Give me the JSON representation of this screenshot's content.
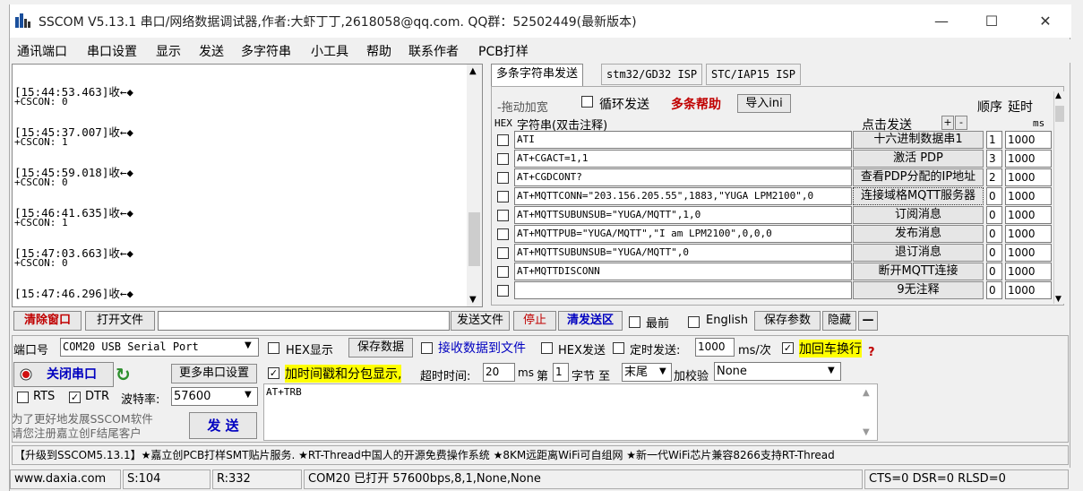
{
  "window": {
    "title": "SSCOM V5.13.1 串口/网络数据调试器,作者:大虾丁丁,2618058@qq.com. QQ群：52502449(最新版本)",
    "min_symbol": "—",
    "max_symbol": "☐",
    "close_symbol": "✕"
  },
  "menu": [
    "通讯端口",
    "串口设置",
    "显示",
    "发送",
    "多字符串",
    "小工具",
    "帮助",
    "联系作者",
    "PCB打样"
  ],
  "receive": {
    "lines": [
      {
        "ts": "[15:44:53.463]收←◆",
        "val": "+CSCON: 0"
      },
      {
        "ts": "[15:45:37.007]收←◆",
        "val": "+CSCON: 1"
      },
      {
        "ts": "[15:45:59.018]收←◆",
        "val": "+CSCON: 0"
      },
      {
        "ts": "[15:46:41.635]收←◆",
        "val": "+CSCON: 1"
      },
      {
        "ts": "[15:47:03.663]收←◆",
        "val": "+CSCON: 0"
      },
      {
        "ts": "[15:47:46.296]收←◆",
        "val": ""
      }
    ]
  },
  "tabs": [
    "多条字符串发送",
    "stm32/GD32 ISP",
    "STC/IAP15 ISP"
  ],
  "multi": {
    "drag_label": "-拖动加宽",
    "loop_label": "循环发送",
    "help_label": "多条帮助",
    "import_label": "导入ini",
    "order_header": "顺序",
    "delay_header": "延时",
    "ms_label": "ms",
    "hex_header": "HEX",
    "str_header": "字符串(双击注释)",
    "click_header": "点击发送",
    "plus": "+",
    "minus": "-",
    "rows": [
      {
        "cmd": "ATI",
        "btn": "十六进制数据串1",
        "order": "1",
        "delay": "1000"
      },
      {
        "cmd": "AT+CGACT=1,1",
        "btn": "激活 PDP",
        "order": "3",
        "delay": "1000"
      },
      {
        "cmd": "AT+CGDCONT?",
        "btn": "查看PDP分配的IP地址",
        "order": "2",
        "delay": "1000"
      },
      {
        "cmd": "AT+MQTTCONN=\"203.156.205.55\",1883,\"YUGA LPM2100\",0",
        "btn": "连接域格MQTT服务器",
        "order": "0",
        "delay": "1000"
      },
      {
        "cmd": "AT+MQTTSUBUNSUB=\"YUGA/MQTT\",1,0",
        "btn": "订阅消息",
        "order": "0",
        "delay": "1000"
      },
      {
        "cmd": "AT+MQTTPUB=\"YUGA/MQTT\",\"I am LPM2100\",0,0,0",
        "btn": "发布消息",
        "order": "0",
        "delay": "1000"
      },
      {
        "cmd": "AT+MQTTSUBUNSUB=\"YUGA/MQTT\",0",
        "btn": "退订消息",
        "order": "0",
        "delay": "1000"
      },
      {
        "cmd": "AT+MQTTDISCONN",
        "btn": "断开MQTT连接",
        "order": "0",
        "delay": "1000"
      },
      {
        "cmd": "",
        "btn": "9无注释",
        "order": "0",
        "delay": "1000"
      }
    ]
  },
  "toolbar": {
    "clear": "清除窗口",
    "open_file": "打开文件",
    "send_file": "发送文件",
    "stop": "停止",
    "clear_send": "清发送区",
    "front": "最前",
    "english": "English",
    "save_params": "保存参数",
    "hide": "隐藏",
    "dash": "—"
  },
  "settings": {
    "port_label": "端口号",
    "port_value": "COM20 USB Serial Port",
    "hex_display": "HEX显示",
    "save_data": "保存数据",
    "recv_to_file": "接收数据到文件",
    "hex_send": "HEX发送",
    "timed_send": "定时发送:",
    "timed_value": "1000",
    "ms_per": "ms/次",
    "add_crlf": "加回车换行",
    "question": "?",
    "close_port": "关闭串口",
    "more_settings": "更多串口设置",
    "add_timestamp": "加时间戳和分包显示,",
    "timeout_label": "超时时间:",
    "timeout_value": "20",
    "ms": "ms",
    "byte_no_label": "第",
    "byte_no": "1",
    "byte_to": "字节 至",
    "byte_end": "末尾",
    "checksum_label": "加校验",
    "checksum_value": "None",
    "rts": "RTS",
    "dtr": "DTR",
    "baud_label": "波特率:",
    "baud_value": "57600",
    "send_text": "AT+TRB",
    "promo": "为了更好地发展SSCOM软件\n请您注册嘉立创F结尾客户",
    "send_btn": "发 送"
  },
  "marquee": "【升级到SSCOM5.13.1】★嘉立创PCB打样SMT贴片服务. ★RT-Thread中国人的开源免费操作系统 ★8KM远距离WiFi可自组网 ★新一代WiFi芯片兼容8266支持RT-Thread",
  "status": {
    "site": "www.daxia.com",
    "sent": "S:104",
    "recv": "R:332",
    "port_state": "COM20 已打开  57600bps,8,1,None,None",
    "lines": "CTS=0 DSR=0 RLSD=0"
  },
  "colors": {
    "accent_red": "#c00000",
    "highlight": "#ffff00",
    "link_blue": "#0000c0"
  }
}
